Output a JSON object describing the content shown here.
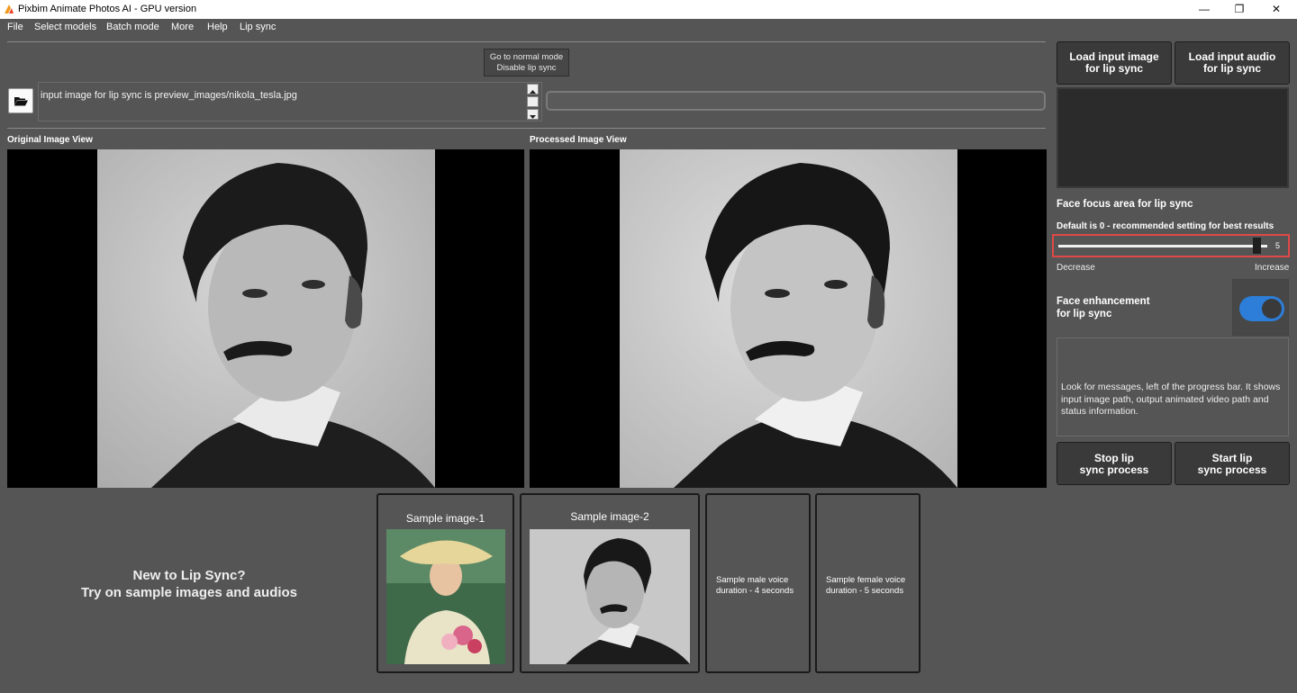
{
  "window": {
    "title": "Pixbim Animate Photos AI - GPU version",
    "minimize": "—",
    "restore": "❐",
    "close": "✕"
  },
  "menu": [
    "File",
    "Select models",
    "Batch mode",
    "More",
    "Help",
    "Lip sync"
  ],
  "mode_button": {
    "line1": "Go to normal mode",
    "line2": "Disable lip sync"
  },
  "message": "input image for lip sync is preview_images/nikola_tesla.jpg",
  "original_view_label": "Original Image View",
  "processed_view_label": "Processed Image View",
  "cta": {
    "line1": "New to Lip Sync?",
    "line2": "Try on sample images and audios"
  },
  "samples": {
    "image1": "Sample image-1",
    "image2": "Sample image-2",
    "male_line1": "Sample male voice",
    "male_line2": "duration - 4 seconds",
    "female_line1": "Sample female voice",
    "female_line2": "duration - 5 seconds"
  },
  "right_panel": {
    "load_image_line1": "Load input image",
    "load_image_line2": "for lip sync",
    "load_audio_line1": "Load input audio",
    "load_audio_line2": "for lip sync",
    "face_focus_label": "Face focus area for lip sync",
    "default_note": "Default is 0 - recommended setting for best results",
    "slider_value": "5",
    "slider_fraction": 0.97,
    "decrease": "Decrease",
    "increase": "Increase",
    "enhance_line1": "Face enhancement",
    "enhance_line2": "for lip sync",
    "enhance_on": true,
    "info_text": "Look for messages, left of the progress bar. It shows input image path, output animated video path and status information.",
    "stop_line1": "Stop lip",
    "stop_line2": "sync process",
    "start_line1": "Start lip",
    "start_line2": "sync process"
  },
  "colors": {
    "background": "#555555",
    "toggle_on": "#2c7ed8",
    "slider_highlight": "#e04848"
  }
}
